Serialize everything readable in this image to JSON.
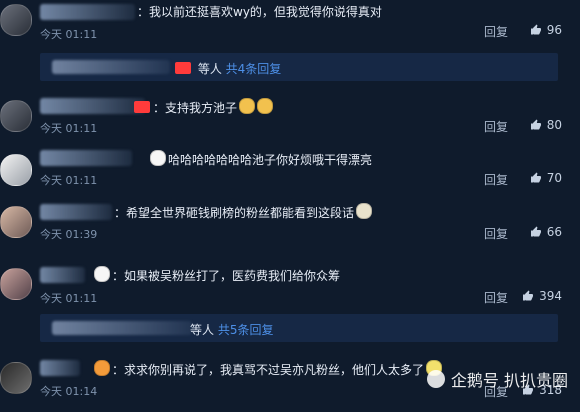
{
  "comments": [
    {
      "text": "：我以前还挺喜欢wy的，但我觉得你说得真对",
      "time": "今天 01:11",
      "reply": "回复",
      "likes": "96"
    },
    {
      "bar_text": "等人",
      "bar_link": "共4条回复"
    },
    {
      "text": "：支持我方池子",
      "time": "今天 01:11",
      "reply": "回复",
      "likes": "80"
    },
    {
      "text": "哈哈哈哈哈哈哈池子你好烦哦干得漂亮",
      "time": "今天 01:11",
      "reply": "回复",
      "likes": "70"
    },
    {
      "text": "：希望全世界砸钱刷榜的粉丝都能看到这段话",
      "time": "今天 01:39",
      "reply": "回复",
      "likes": "66"
    },
    {
      "text": "：如果被吴粉丝打了，医药费我们给你众筹",
      "time": "今天 01:11",
      "reply": "回复",
      "likes": "394"
    },
    {
      "bar_text": "等人",
      "bar_link": "共5条回复"
    },
    {
      "text": "：求求你别再说了，我真骂不过吴亦凡粉丝，他们人太多了",
      "time": "今天 01:14",
      "reply": "回复",
      "likes": "318"
    }
  ],
  "watermark": "企鹅号 扒扒贵圈"
}
